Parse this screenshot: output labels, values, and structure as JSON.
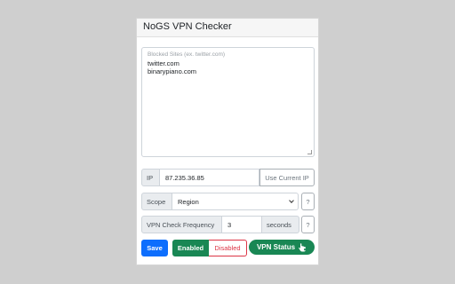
{
  "panel": {
    "title": "NoGS VPN Checker"
  },
  "blocked_sites": {
    "placeholder": "Blocked Sites (ex. twitter.com)",
    "entries": [
      "twitter.com",
      "binarypiano.com"
    ]
  },
  "ip": {
    "label": "IP",
    "value": "87.235.36.85",
    "use_current_label": "Use Current IP"
  },
  "scope": {
    "label": "Scope",
    "selected": "Region",
    "help": "?"
  },
  "frequency": {
    "label": "VPN Check Frequency",
    "value": "3",
    "unit": "seconds",
    "help": "?"
  },
  "actions": {
    "save_label": "Save",
    "enabled_label": "Enabled",
    "disabled_label": "Disabled",
    "status_label": "VPN Status",
    "status_icon": "hand-pointer-icon"
  },
  "colors": {
    "primary": "#0d6efd",
    "success": "#198754",
    "danger": "#dc3545"
  }
}
